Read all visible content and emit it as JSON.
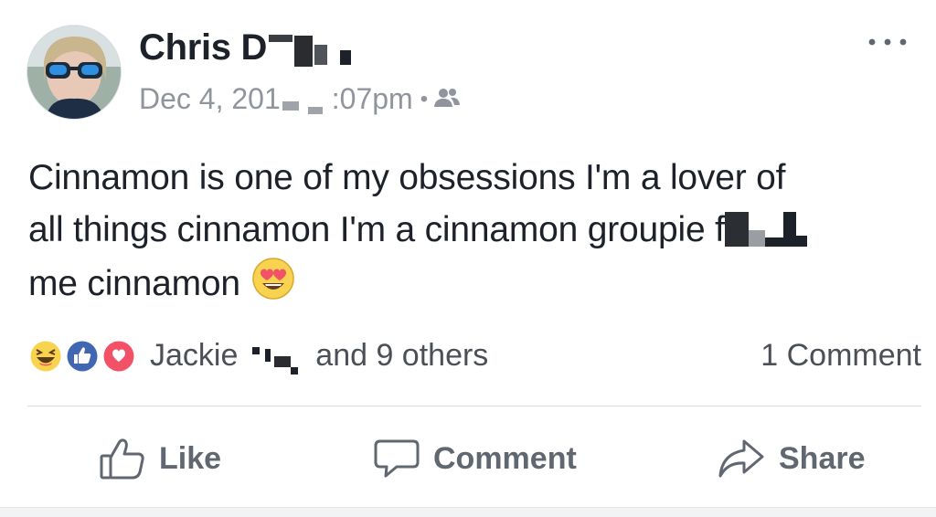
{
  "post": {
    "author_visible": "Chris D",
    "timestamp_prefix": "Dec 4, 201",
    "timestamp_suffix": ":07pm",
    "separator": "•",
    "audience_icon": "friends-icon",
    "menu_icon": "more-options-icon",
    "text_line_1": "Cinnamon is one of my obsessions I'm a lover of",
    "text_line_2": "all things cinnamon I'm a cinnamon groupie f",
    "text_line_3": "me cinnamon",
    "text_emoji": "heart-eyes-emoji-icon"
  },
  "reactions": {
    "icons": [
      "haha-icon",
      "like-icon",
      "love-icon"
    ],
    "reactor_first": "Jackie",
    "reactor_rest": "and 9 others",
    "comment_count": "1 Comment"
  },
  "actions": {
    "like_label": "Like",
    "comment_label": "Comment",
    "share_label": "Share"
  },
  "colors": {
    "text_primary": "#1d2129",
    "text_secondary": "#90949c",
    "action_gray": "#606770",
    "like_blue": "#4267b2",
    "love_red": "#f25268",
    "haha_yellow": "#f7d350",
    "divider": "#dddfe2"
  }
}
